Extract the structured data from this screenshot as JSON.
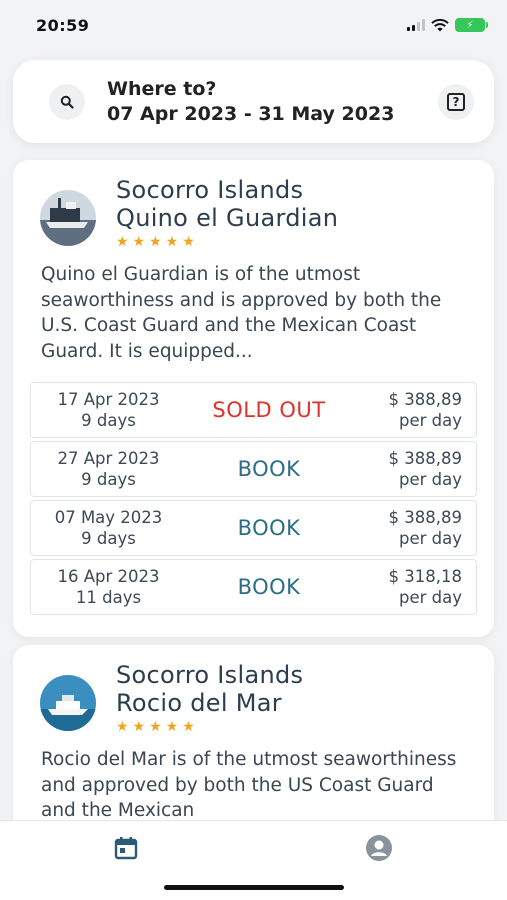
{
  "status_bar": {
    "time": "20:59"
  },
  "search": {
    "title": "Where to?",
    "dates": "07 Apr 2023 - 31 May 2023",
    "help_icon_glyph": "?"
  },
  "trips": [
    {
      "title_line1": "Socorro Islands",
      "title_line2": "Quino el Guardian",
      "stars": "★★★★★",
      "description": "Quino el Guardian is of the utmost seaworthiness and is approved by both the U.S. Coast Guard and the Mexican Coast Guard. It is equipped...",
      "departures": [
        {
          "date": "17 Apr 2023",
          "duration": "9 days",
          "action": "SOLD OUT",
          "price": "$ 388,89",
          "unit": "per day"
        },
        {
          "date": "27 Apr 2023",
          "duration": "9 days",
          "action": "BOOK",
          "price": "$ 388,89",
          "unit": "per day"
        },
        {
          "date": "07 May 2023",
          "duration": "9 days",
          "action": "BOOK",
          "price": "$ 388,89",
          "unit": "per day"
        },
        {
          "date": "16 Apr 2023",
          "duration": "11 days",
          "action": "BOOK",
          "price": "$ 318,18",
          "unit": "per day"
        }
      ]
    },
    {
      "title_line1": "Socorro Islands",
      "title_line2": "Rocio del Mar",
      "stars": "★★★★★",
      "description": "Rocio del Mar is of the utmost seaworthiness and approved by both the US Coast Guard and the Mexican"
    }
  ],
  "colors": {
    "sold_out": "#e0312d",
    "book": "#2b6c86",
    "stars": "#f0a421",
    "nav_icon": "#2b5c75"
  },
  "icons": {
    "search": "search-icon",
    "help": "help-icon",
    "bookings": "calendar-icon",
    "profile": "profile-icon"
  }
}
